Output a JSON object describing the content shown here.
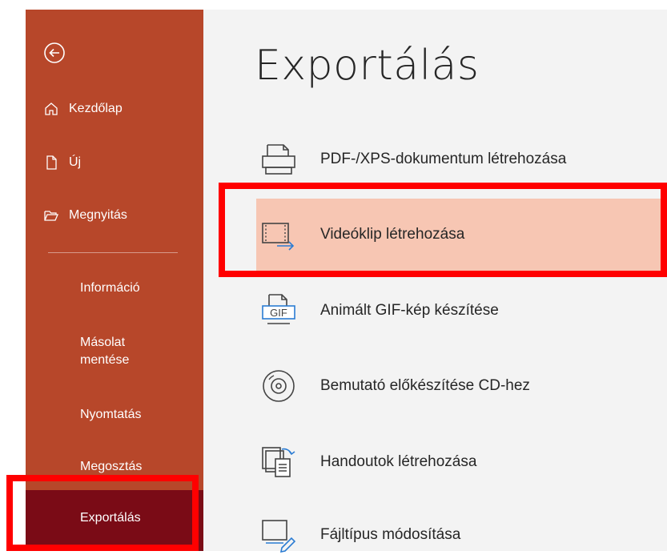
{
  "sidebar": {
    "back_label": "",
    "items_top": [
      {
        "label": "Kezdőlap",
        "icon": "home-icon"
      },
      {
        "label": "Új",
        "icon": "new-document-icon"
      },
      {
        "label": "Megnyitás",
        "icon": "folder-open-icon"
      }
    ],
    "items_bottom": [
      {
        "label": "Információ"
      },
      {
        "label": "Másolat mentése"
      },
      {
        "label": "Nyomtatás"
      },
      {
        "label": "Megosztás"
      },
      {
        "label": "Exportálás"
      }
    ]
  },
  "main": {
    "title": "Exportálás",
    "options": [
      {
        "label": "PDF-/XPS-dokumentum létrehozása",
        "icon": "pdf-xps-icon"
      },
      {
        "label": "Videóklip létrehozása",
        "icon": "video-icon",
        "selected": true
      },
      {
        "label": "Animált GIF-kép készítése",
        "icon": "gif-icon",
        "icon_text": "GIF"
      },
      {
        "label": "Bemutató előkészítése CD-hez",
        "icon": "cd-icon"
      },
      {
        "label": "Handoutok létrehozása",
        "icon": "handouts-icon"
      },
      {
        "label": "Fájltípus módosítása",
        "icon": "change-file-type-icon"
      }
    ]
  },
  "colors": {
    "sidebar_bg": "#b7472a",
    "active_bg": "#7a0b16",
    "selected_bg": "#f7c6b3",
    "highlight": "#ff0000"
  }
}
